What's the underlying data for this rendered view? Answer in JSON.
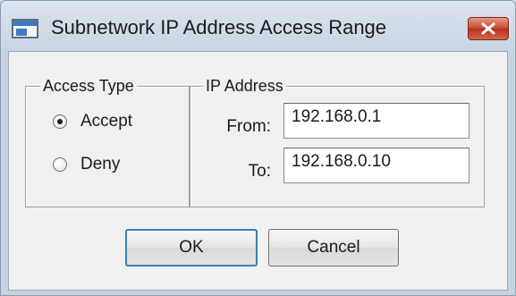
{
  "window": {
    "title": "Subnetwork IP Address Access Range",
    "icon": "app-window-icon",
    "close_icon": "close-icon"
  },
  "access_type": {
    "legend": "Access Type",
    "options": [
      {
        "label": "Accept",
        "selected": true
      },
      {
        "label": "Deny",
        "selected": false
      }
    ]
  },
  "ip_address": {
    "legend": "IP Address",
    "from_label": "From:",
    "from_value": "192.168.0.1",
    "to_label": "To:",
    "to_value": "192.168.0.10"
  },
  "buttons": {
    "ok_label": "OK",
    "cancel_label": "Cancel"
  },
  "colors": {
    "close_button": "#c8462d",
    "default_button_border": "#3c7fb1"
  }
}
